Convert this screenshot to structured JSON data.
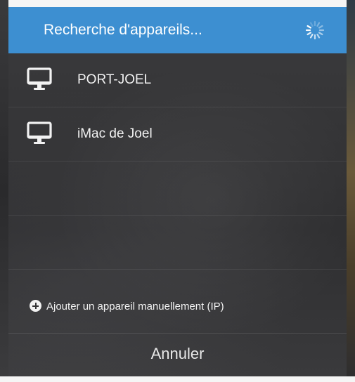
{
  "header": {
    "title": "Recherche d'appareils...",
    "spinner_icon": "loading-spinner-icon",
    "color": "#3d8fd1"
  },
  "devices": [
    {
      "label": "PORT-JOEL",
      "icon": "monitor-icon"
    },
    {
      "label": "iMac de Joel",
      "icon": "monitor-icon"
    }
  ],
  "add_device": {
    "label": "Ajouter un appareil manuellement (IP)",
    "icon": "plus-circle-icon"
  },
  "cancel": {
    "label": "Annuler"
  }
}
